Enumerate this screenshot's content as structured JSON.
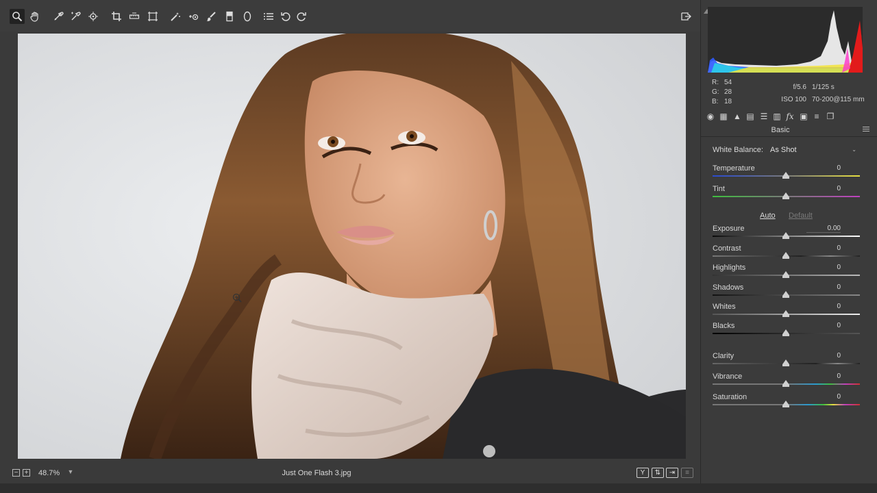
{
  "toolbar": {
    "tools": [
      {
        "name": "zoom-tool",
        "icon": "magnifier-icon",
        "active": true
      },
      {
        "name": "hand-tool",
        "icon": "hand-icon"
      },
      {
        "name": "white-balance-tool",
        "icon": "eyedropper-icon"
      },
      {
        "name": "color-sampler-tool",
        "icon": "color-sampler-icon"
      },
      {
        "name": "targeted-adjustment-tool",
        "icon": "target-adjust-icon"
      },
      {
        "name": "crop-tool",
        "icon": "crop-icon"
      },
      {
        "name": "straighten-tool",
        "icon": "straighten-icon"
      },
      {
        "name": "transform-tool",
        "icon": "transform-icon"
      },
      {
        "name": "spot-removal-tool",
        "icon": "spot-removal-icon"
      },
      {
        "name": "red-eye-tool",
        "icon": "red-eye-icon"
      },
      {
        "name": "adjustment-brush-tool",
        "icon": "brush-icon"
      },
      {
        "name": "graduated-filter-tool",
        "icon": "graduated-filter-icon"
      },
      {
        "name": "radial-filter-tool",
        "icon": "radial-filter-icon"
      },
      {
        "name": "preferences-tool",
        "icon": "list-icon"
      },
      {
        "name": "rotate-left-tool",
        "icon": "rotate-ccw-icon"
      },
      {
        "name": "rotate-right-tool",
        "icon": "rotate-cw-icon"
      }
    ]
  },
  "status": {
    "zoom": "48.7%",
    "filename": "Just One Flash 3.jpg"
  },
  "histogram": {
    "rgb": {
      "r_label": "R:",
      "r": "54",
      "g_label": "G:",
      "g": "28",
      "b_label": "B:",
      "b": "18"
    },
    "aperture": "f/5.6",
    "shutter": "1/125 s",
    "iso": "ISO 100",
    "lens": "70-200@115 mm"
  },
  "panel": {
    "title": "Basic",
    "white_balance_label": "White Balance:",
    "white_balance_value": "As Shot",
    "auto_label": "Auto",
    "default_label": "Default",
    "sliders": {
      "temperature": {
        "label": "Temperature",
        "value": "0"
      },
      "tint": {
        "label": "Tint",
        "value": "0"
      },
      "exposure": {
        "label": "Exposure",
        "value": "0.00"
      },
      "contrast": {
        "label": "Contrast",
        "value": "0"
      },
      "highlights": {
        "label": "Highlights",
        "value": "0"
      },
      "shadows": {
        "label": "Shadows",
        "value": "0"
      },
      "whites": {
        "label": "Whites",
        "value": "0"
      },
      "blacks": {
        "label": "Blacks",
        "value": "0"
      },
      "clarity": {
        "label": "Clarity",
        "value": "0"
      },
      "vibrance": {
        "label": "Vibrance",
        "value": "0"
      },
      "saturation": {
        "label": "Saturation",
        "value": "0"
      }
    }
  },
  "colors": {
    "panel_bg": "#3b3b3b",
    "temperature_start": "#2a4bd0",
    "temperature_end": "#e8e040",
    "tint_start": "#3fbf3f",
    "tint_end": "#c040c0"
  }
}
